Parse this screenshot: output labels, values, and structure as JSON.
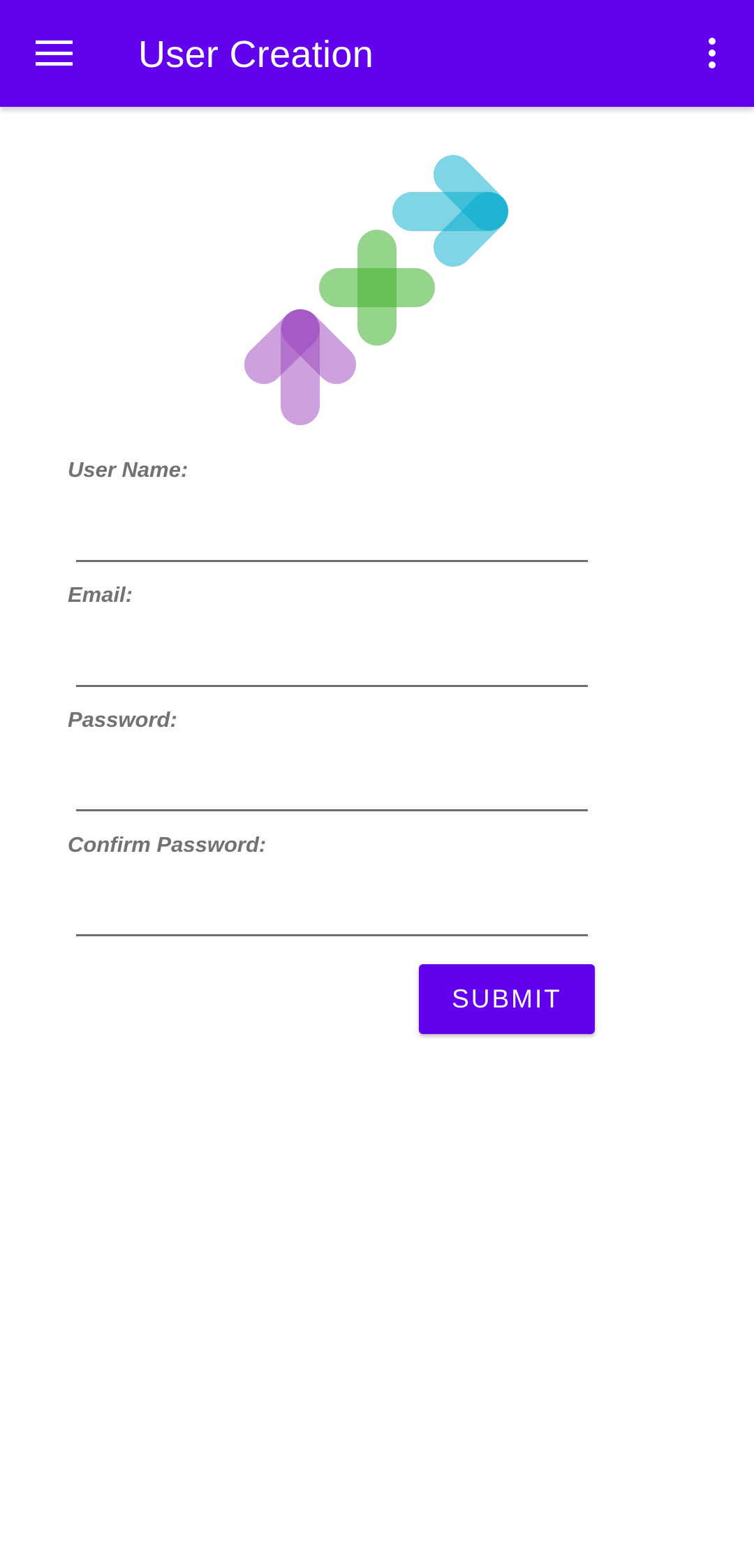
{
  "app_bar": {
    "title": "User Creation",
    "menu_icon": "hamburger-menu-icon",
    "overflow_icon": "more-vertical-icon",
    "color": "#6200ee"
  },
  "logo": {
    "icon": "arrows-plus-logo",
    "colors": {
      "cyan": "#00aacc",
      "green": "#3eb02c",
      "purple": "#9a44bb"
    }
  },
  "form": {
    "username_label": "User Name:",
    "username_value": "",
    "email_label": "Email:",
    "email_value": "",
    "password_label": "Password:",
    "password_value": "",
    "confirm_password_label": "Confirm Password:",
    "confirm_password_value": "",
    "submit_label": "SUBMIT"
  }
}
